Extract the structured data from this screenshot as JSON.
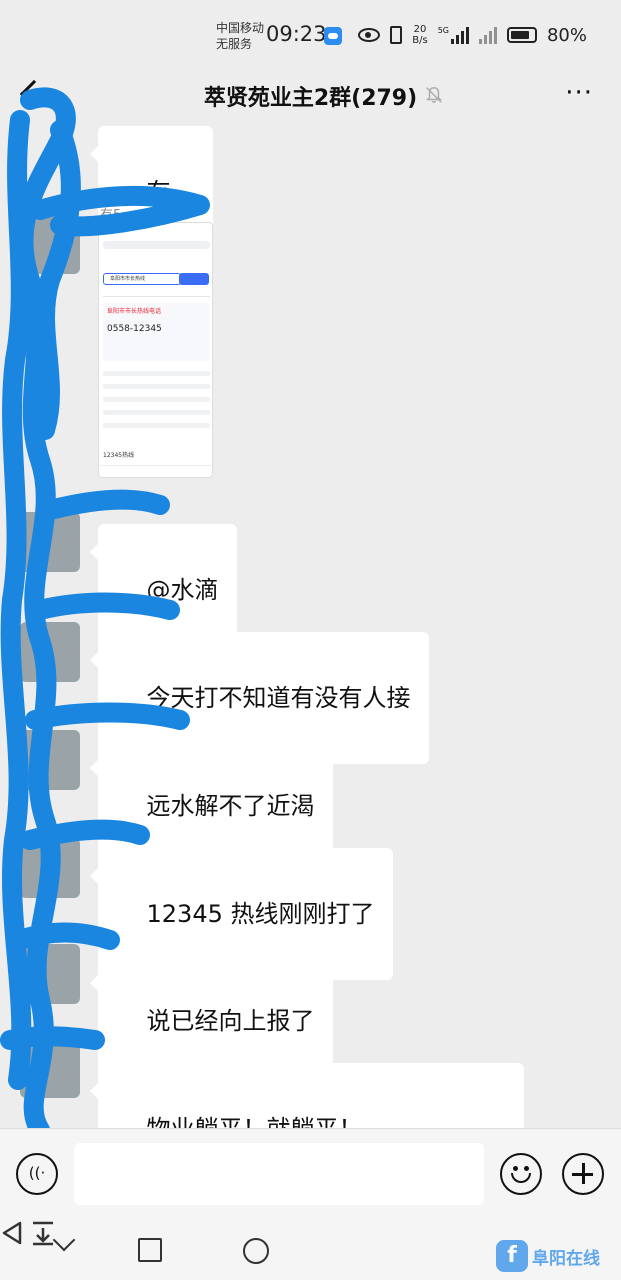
{
  "status_bar": {
    "carrier_line1": "中国移动",
    "carrier_line2": "无服务",
    "time": "09:23",
    "net_speed_value": "20",
    "net_speed_unit": "B/s",
    "signal_label": "5G",
    "battery_percent": "80%",
    "battery_level": 0.8
  },
  "header": {
    "title": "萃贤苑业主2群(279)",
    "back_icon": "chevron-left-icon",
    "mute_icon": "bell-off-icon",
    "more_icon": "more-dots-icon",
    "more_glyph": "···"
  },
  "messages": [
    {
      "type": "text",
      "text": "有。"
    },
    {
      "type": "image",
      "sender": "有5"
    },
    {
      "type": "text",
      "text": "@水滴"
    },
    {
      "type": "text",
      "text": "今天打不知道有没有人接"
    },
    {
      "type": "text",
      "text": "远水解不了近渴"
    },
    {
      "type": "text",
      "text": "12345 热线刚刚打了"
    },
    {
      "type": "text",
      "text": "说已经向上报了"
    },
    {
      "type": "text",
      "text": "物业躺平！就躺平！\n任你怎么说不理睬，就是不理睬"
    }
  ],
  "shared_screenshot": {
    "query": "阜阳市市长热线",
    "card_title": "阜阳市市长热线电话",
    "phone": "0558-12345",
    "bottom_text": "12345热线"
  },
  "input_bar": {
    "voice_icon": "voice-icon",
    "voice_glyph": "((·",
    "emoji_icon": "emoji-icon",
    "plus_icon": "plus-icon",
    "placeholder": ""
  },
  "system_nav": {
    "icons": [
      "chevron-down-icon",
      "square-icon",
      "circle-icon",
      "triangle-back-icon",
      "pull-down-icon"
    ]
  },
  "watermark": {
    "logo": "f",
    "text": "阜阳在线"
  },
  "colors": {
    "background": "#ededed",
    "bubble": "#ffffff",
    "scribble": "#1a86e0",
    "link_blue": "#3a6cf4"
  }
}
